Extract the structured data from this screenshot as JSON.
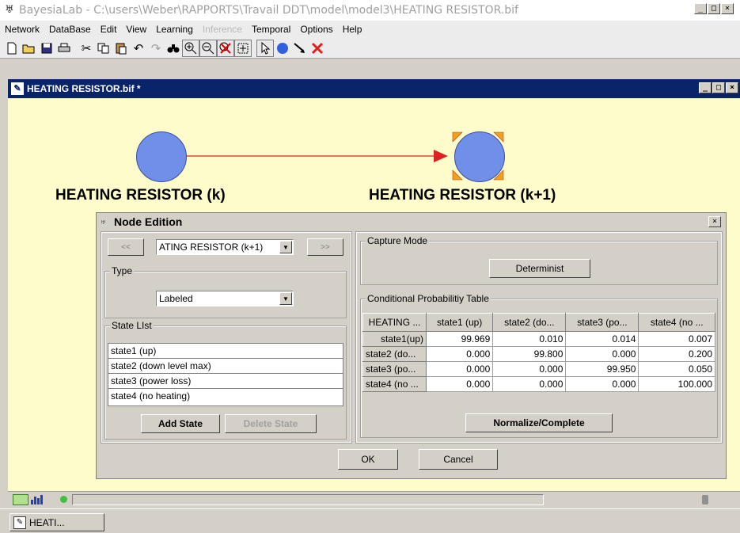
{
  "window": {
    "title": "BayesiaLab - C:\\users\\Weber\\RAPPORTS\\Travail DDT\\model\\model3\\HEATING RESISTOR.bif"
  },
  "menu": [
    "Network",
    "DataBase",
    "Edit",
    "View",
    "Learning",
    "Inference",
    "Temporal",
    "Options",
    "Help"
  ],
  "menu_disabled": [
    "Inference"
  ],
  "document": {
    "title": "HEATING RESISTOR.bif *"
  },
  "nodes": {
    "left_label": "HEATING RESISTOR (k)",
    "right_label": "HEATING RESISTOR (k+1)"
  },
  "dialog": {
    "title": "Node Edition",
    "prev_label": "<<",
    "next_label": ">>",
    "node_select": "ATING RESISTOR (k+1)",
    "type_group": "Type",
    "type_value": "Labeled",
    "state_list_group": "State LIst",
    "states": [
      "state1 (up)",
      "state2 (down level max)",
      "state3 (power loss)",
      "state4 (no heating)"
    ],
    "add_state": "Add State",
    "delete_state": "Delete State",
    "capture_group": "Capture Mode",
    "capture_value": "Determinist",
    "cpt_group": "Conditional Probabilitiy Table",
    "cpt_headers": [
      "HEATING ...",
      "state1 (up)",
      "state2 (do...",
      "state3 (po...",
      "state4 (no ..."
    ],
    "cpt_rows": [
      {
        "label": "state1(up)",
        "values": [
          "99.969",
          "0.010",
          "0.014",
          "0.007"
        ]
      },
      {
        "label": "state2 (do...",
        "values": [
          "0.000",
          "99.800",
          "0.000",
          "0.200"
        ]
      },
      {
        "label": "state3 (po...",
        "values": [
          "0.000",
          "0.000",
          "99.950",
          "0.050"
        ]
      },
      {
        "label": "state4 (no ...",
        "values": [
          "0.000",
          "0.000",
          "0.000",
          "100.000"
        ]
      }
    ],
    "normalize": "Normalize/Complete",
    "ok": "OK",
    "cancel": "Cancel"
  },
  "taskbar": {
    "item": "HEATI..."
  },
  "colors": {
    "node_fill": "#6f8fe8",
    "canvas_bg": "#fffccc",
    "arc": "#e02020",
    "title_active": "#0a246a"
  }
}
